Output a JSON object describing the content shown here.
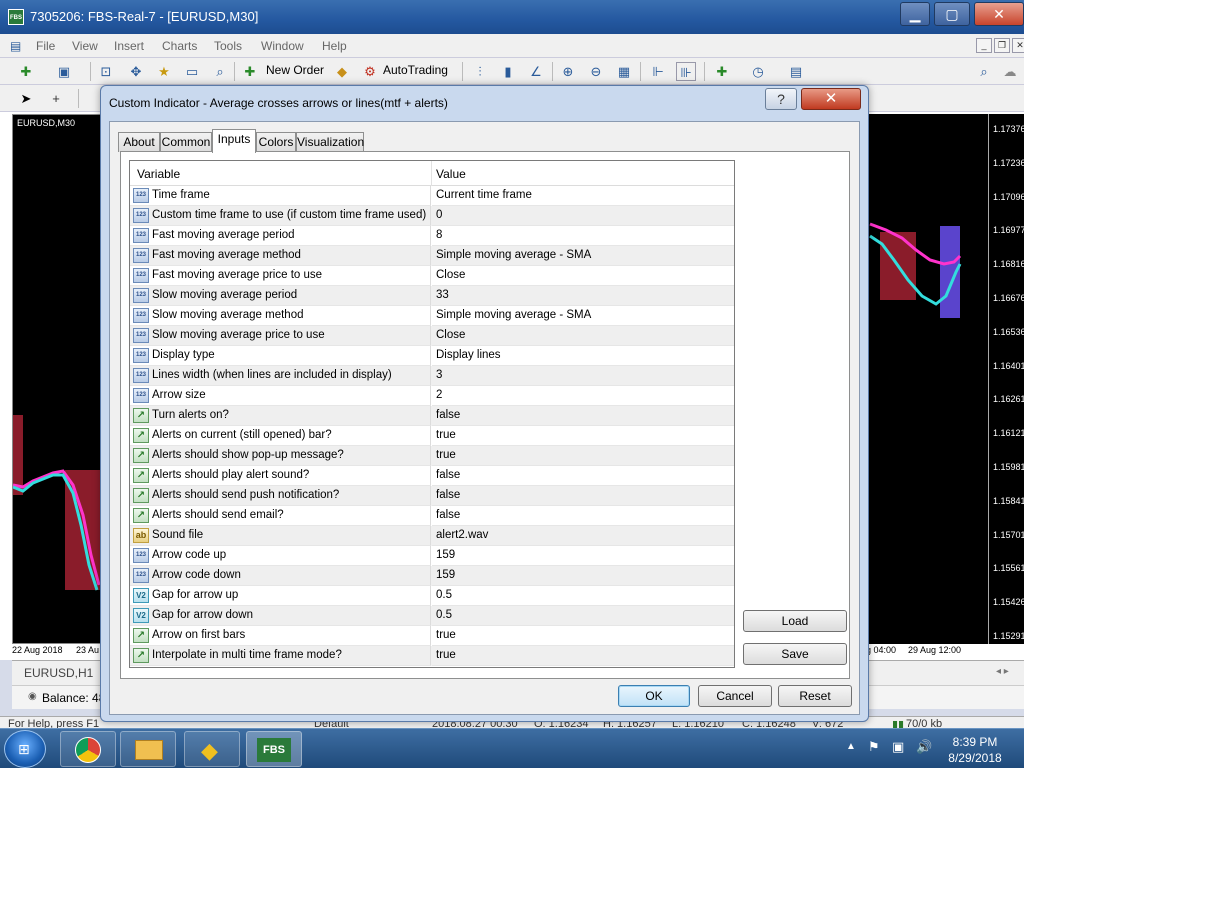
{
  "window": {
    "title": "7305206: FBS-Real-7 - [EURUSD,M30]",
    "app_icon": "FBS"
  },
  "menu": [
    "File",
    "View",
    "Insert",
    "Charts",
    "Tools",
    "Window",
    "Help"
  ],
  "toolbar": {
    "new_order": "New Order",
    "autotrading": "AutoTrading"
  },
  "chart": {
    "symbol_label": "EURUSD,M30",
    "prices": [
      "1.17376",
      "1.17236",
      "1.17096",
      "1.16977",
      "1.16816",
      "1.16676",
      "1.16536",
      "1.16401",
      "1.16261",
      "1.16121",
      "1.15981",
      "1.15841",
      "1.15701",
      "1.15561",
      "1.15426",
      "1.15291"
    ],
    "time_left": [
      "22 Aug 2018",
      "23 Au"
    ],
    "time_right": [
      "g 04:00",
      "29 Aug 12:00"
    ]
  },
  "bottom": {
    "tab": "EURUSD,H1",
    "balance": "Balance: 48"
  },
  "status": {
    "help": "For Help, press F1",
    "profile": "Default",
    "datetime": "2018.08.27 00:30",
    "open": "O: 1.16234",
    "high": "H: 1.16257",
    "low": "L: 1.16210",
    "close": "C: 1.16248",
    "volume": "V: 672",
    "traffic": "70/0 kb"
  },
  "taskbar": {
    "time": "8:39 PM",
    "date": "8/29/2018",
    "fbs": "FBS"
  },
  "dialog": {
    "title": "Custom Indicator - Average crosses arrows or lines(mtf + alerts)",
    "help": "?",
    "close": "✕",
    "tabs": [
      "About",
      "Common",
      "Inputs",
      "Colors",
      "Visualization"
    ],
    "active_tab": "Inputs",
    "col_variable": "Variable",
    "col_value": "Value",
    "rows": [
      {
        "type": "int",
        "name": "Time frame",
        "value": "Current time frame"
      },
      {
        "type": "int",
        "name": "Custom time frame to use (if custom time frame used)",
        "value": "0"
      },
      {
        "type": "int",
        "name": "Fast moving average period",
        "value": "8"
      },
      {
        "type": "int",
        "name": "Fast moving average method",
        "value": "Simple moving average - SMA"
      },
      {
        "type": "int",
        "name": "Fast moving average price to use",
        "value": "Close"
      },
      {
        "type": "int",
        "name": "Slow moving average period",
        "value": "33"
      },
      {
        "type": "int",
        "name": "Slow moving average method",
        "value": "Simple moving average - SMA"
      },
      {
        "type": "int",
        "name": "Slow moving average price to use",
        "value": "Close"
      },
      {
        "type": "int",
        "name": "Display type",
        "value": "Display lines"
      },
      {
        "type": "int",
        "name": "Lines width (when lines are included in display)",
        "value": "3"
      },
      {
        "type": "int",
        "name": "Arrow size",
        "value": "2"
      },
      {
        "type": "bool",
        "name": "Turn alerts on?",
        "value": "false"
      },
      {
        "type": "bool",
        "name": "Alerts on current (still opened) bar?",
        "value": "true"
      },
      {
        "type": "bool",
        "name": "Alerts should show pop-up message?",
        "value": "true"
      },
      {
        "type": "bool",
        "name": "Alerts should play alert sound?",
        "value": "false"
      },
      {
        "type": "bool",
        "name": "Alerts should send push notification?",
        "value": "false"
      },
      {
        "type": "bool",
        "name": "Alerts should send email?",
        "value": "false"
      },
      {
        "type": "str",
        "name": "Sound file",
        "value": "alert2.wav"
      },
      {
        "type": "int",
        "name": "Arrow code up",
        "value": "159"
      },
      {
        "type": "int",
        "name": "Arrow code down",
        "value": "159"
      },
      {
        "type": "dbl",
        "name": "Gap for arrow up",
        "value": "0.5"
      },
      {
        "type": "dbl",
        "name": "Gap for arrow down",
        "value": "0.5"
      },
      {
        "type": "bool",
        "name": "Arrow on first bars",
        "value": "true"
      },
      {
        "type": "bool",
        "name": "Interpolate in multi time frame mode?",
        "value": "true"
      }
    ],
    "icon_labels": {
      "int": "123",
      "bool": "↗",
      "str": "ab",
      "dbl": "V2"
    },
    "load": "Load",
    "save": "Save",
    "ok": "OK",
    "cancel": "Cancel",
    "reset": "Reset"
  }
}
